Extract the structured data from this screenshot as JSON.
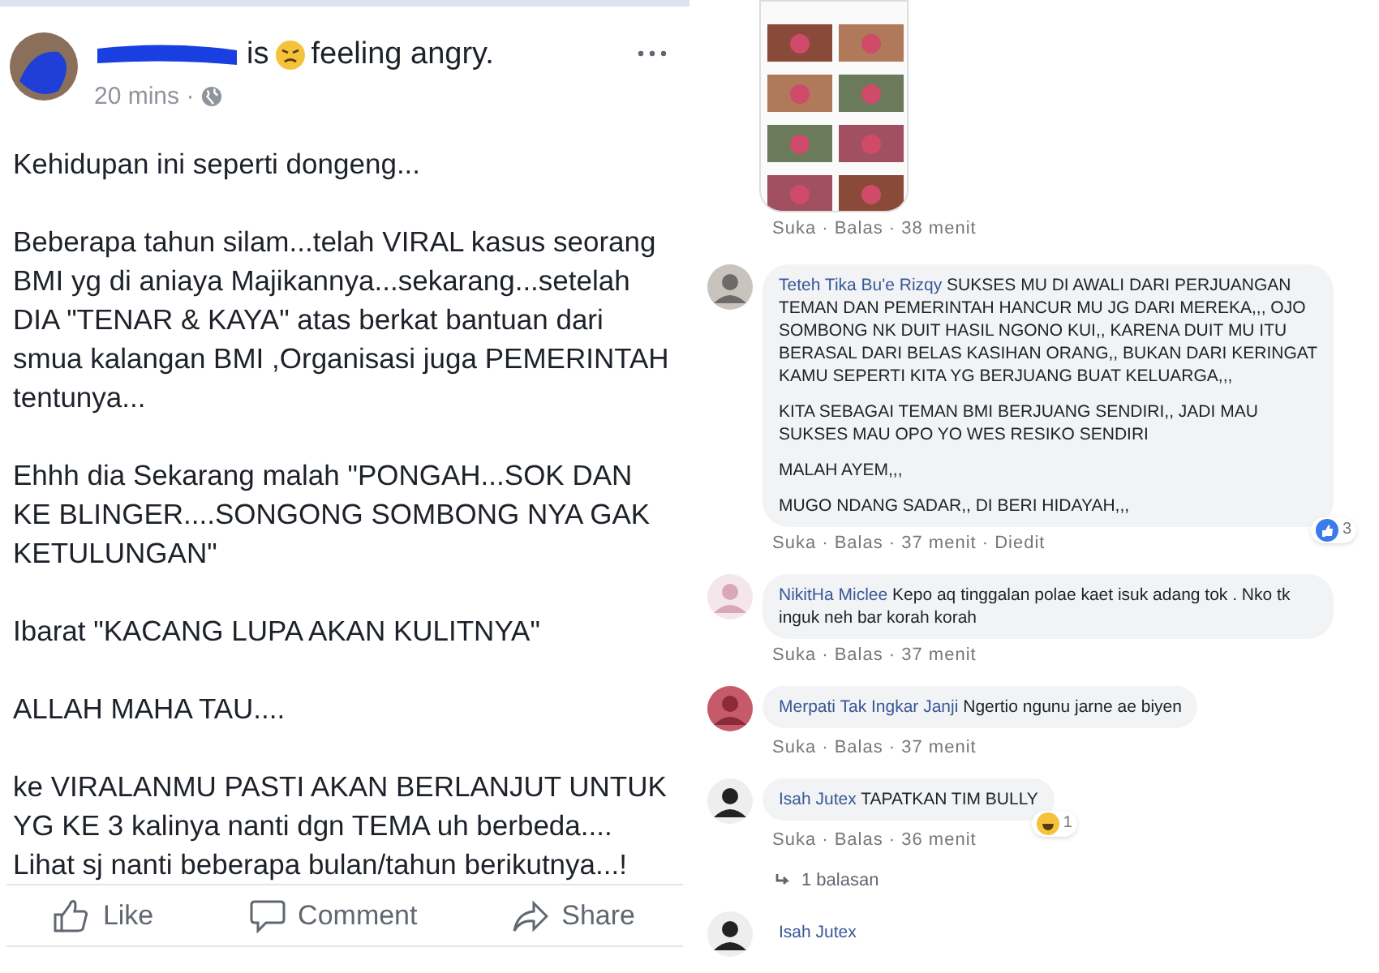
{
  "post": {
    "feeling_prefix": "is",
    "feeling": "feeling angry.",
    "time": "20 mins ·",
    "paragraphs": [
      "Kehidupan ini seperti dongeng...",
      "Beberapa tahun silam...telah VIRAL kasus seorang BMI yg di aniaya Majikannya...sekarang...setelah DIA \"TENAR & KAYA\" atas berkat bantuan dari smua kalangan BMI ,Organisasi juga PEMERINTAH tentunya...",
      "Ehhh dia Sekarang malah \"PONGAH...SOK DAN KE BLINGER....SONGONG SOMBONG NYA GAK KETULUNGAN\"",
      "Ibarat \"KACANG LUPA AKAN KULITNYA\"",
      "ALLAH MAHA TAU....",
      "ke VIRALANMU PASTI AKAN BERLANJUT UNTUK YG KE 3 kalinya nanti dgn TEMA uh berbeda.... Lihat sj nanti beberapa bulan/tahun berikutnya...!"
    ],
    "actions": [
      "Like",
      "Comment",
      "Share"
    ]
  },
  "image_comment": {
    "kind": "picture",
    "meta": "Suka · Balas · 38 menit"
  },
  "comments": [
    {
      "kind": "text",
      "name": "Teteh Tika Bu'e Rizqy",
      "paragraphs": [
        "SUKSES MU DI AWALI DARI PERJUANGAN TEMAN DAN PEMERINTAH HANCUR MU JG DARI MEREKA,,, OJO SOMBONG NK DUIT HASIL NGONO KUI,, KARENA DUIT MU ITU BERASAL DARI BELAS KASIHAN ORANG,, BUKAN DARI KERINGAT KAMU SEPERTI KITA YG BERJUANG BUAT KELUARGA,,,",
        "KITA SEBAGAI TEMAN BMI BERJUANG SENDIRI,, JADI MAU SUKSES MAU OPO YO WES RESIKO SENDIRI",
        "MALAH AYEM,,,",
        "MUGO NDANG SADAR,, DI BERI HIDAYAH,,,"
      ],
      "meta": "Suka · Balas · 37 menit · Diedit",
      "reaction": {
        "kind": "like",
        "count": "3"
      }
    },
    {
      "kind": "text",
      "name": "NikitHa Miclee",
      "paragraphs": [
        "Kepo aq tinggalan polae kaet isuk adang tok . Nko tk inguk neh bar korah korah"
      ],
      "meta": "Suka · Balas · 37 menit"
    },
    {
      "kind": "text",
      "name": "Merpati Tak Ingkar Janji",
      "paragraphs": [
        "Ngertio ngunu jarne ae biyen"
      ],
      "meta": "Suka · Balas · 37 menit"
    },
    {
      "kind": "text",
      "name": "Isah Jutex",
      "paragraphs": [
        "TAPATKAN TIM BULLY"
      ],
      "meta": "Suka · Balas · 36 menit",
      "reaction": {
        "kind": "haha",
        "count": "1"
      },
      "replies": "1 balasan"
    },
    {
      "kind": "name_only",
      "name": "Isah Jutex"
    }
  ]
}
